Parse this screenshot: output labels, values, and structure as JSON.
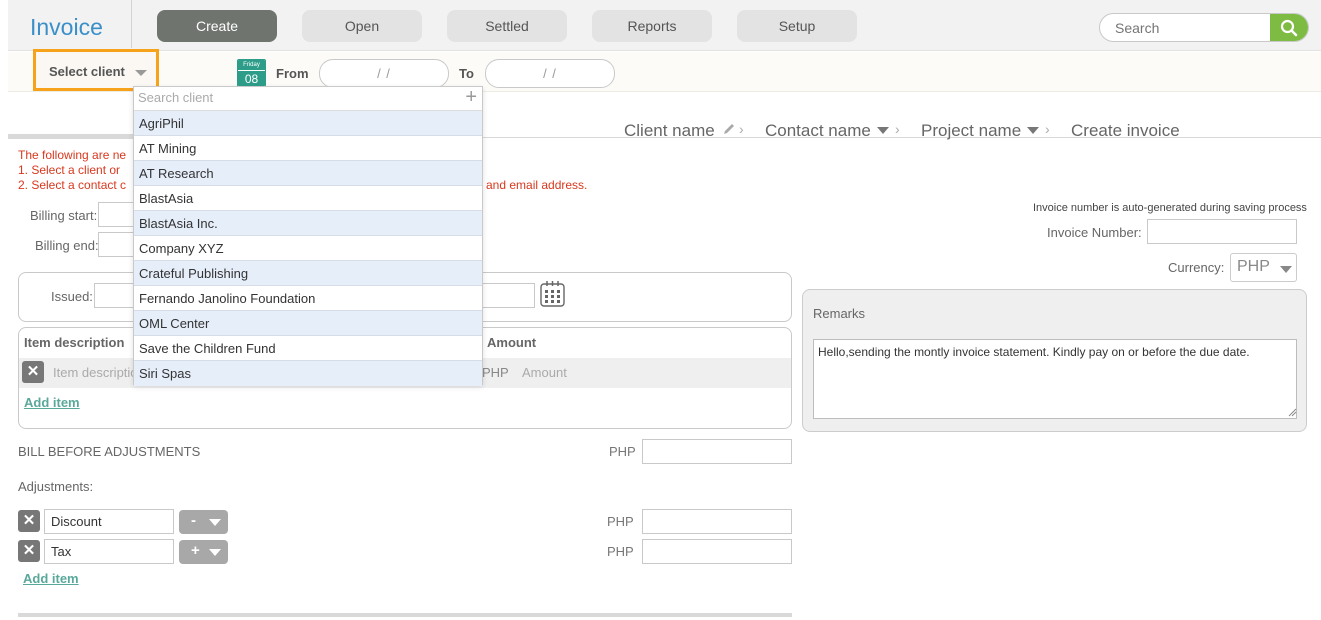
{
  "app": {
    "title": "Invoice"
  },
  "nav": {
    "create": "Create",
    "open": "Open",
    "settled": "Settled",
    "reports": "Reports",
    "setup": "Setup"
  },
  "search": {
    "placeholder": "Search"
  },
  "filter": {
    "select_client": "Select client",
    "calendar_weekday": "Friday",
    "calendar_day": "08",
    "from_label": "From",
    "to_label": "To",
    "from_value": "/ /",
    "to_value": "/ /"
  },
  "breadcrumb": {
    "client_name": "Client name",
    "contact_name": "Contact name",
    "project_name": "Project name",
    "create_invoice": "Create invoice"
  },
  "notice": {
    "line1": "The following are ne",
    "line2": "1. Select a client or",
    "line3": "2. Select a contact c",
    "line3_tail": "and email address."
  },
  "billing": {
    "start_label": "Billing start:",
    "end_label": "Billing end:",
    "issued_label": "Issued:"
  },
  "invoice_info": {
    "note": "Invoice number is auto-generated during saving process",
    "number_label": "Invoice Number:",
    "currency_label": "Currency:",
    "currency_value": "PHP"
  },
  "items": {
    "desc_header": "Item description",
    "amount_header": "Amount",
    "desc_placeholder": "Item descriptio",
    "currency": "PHP",
    "amount_placeholder": "Amount",
    "add_item": "Add item"
  },
  "summary": {
    "bill_before": "BILL BEFORE ADJUSTMENTS",
    "currency": "PHP",
    "adjustments_label": "Adjustments:",
    "discount": "Discount",
    "discount_op": "-",
    "tax": "Tax",
    "tax_op": "+",
    "add_item": "Add item"
  },
  "remarks": {
    "label": "Remarks",
    "text": "Hello,sending the montly invoice statement. Kindly pay on or before the due date."
  },
  "client_dropdown": {
    "search_placeholder": "Search client",
    "add_symbol": "+",
    "clients": [
      "AgriPhil",
      "AT Mining",
      "AT Research",
      "BlastAsia",
      "BlastAsia Inc.",
      "Company XYZ",
      "Crateful Publishing",
      "Fernando Janolino Foundation",
      "OML Center",
      "Save the Children Fund",
      "Siri Spas"
    ]
  },
  "colors": {
    "accent": "#3a8fc9",
    "highlight_border": "#f6a21a",
    "search_button": "#7dbb43",
    "error_text": "#d9381e",
    "link": "#5aa89a"
  }
}
